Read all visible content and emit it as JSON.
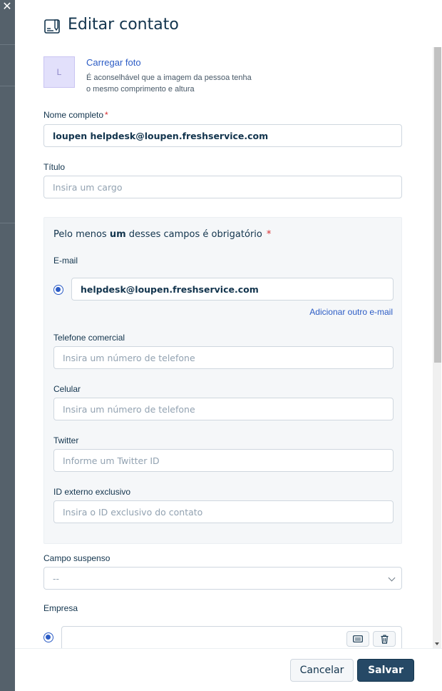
{
  "backdrop": {
    "close_glyph": "✕"
  },
  "header": {
    "title": "Editar contato",
    "icon": "contact-card-edit-icon"
  },
  "photo": {
    "avatar_initial": "L",
    "upload_label": "Carregar foto",
    "hint_line1": "É aconselhável que a imagem da pessoa tenha",
    "hint_line2": "o mesmo comprimento e altura"
  },
  "full_name": {
    "label": "Nome completo",
    "required_mark": "*",
    "value": "loupen helpdesk@loupen.freshservice.com"
  },
  "title_field": {
    "label": "Título",
    "placeholder": "Insira um cargo"
  },
  "required_group": {
    "title_before": "Pelo menos ",
    "title_bold": "um",
    "title_after": " desses campos é obrigatório",
    "required_mark": "*",
    "email": {
      "label": "E-mail",
      "value": "helpdesk@loupen.freshservice.com",
      "add_label": "Adicionar outro e-mail"
    },
    "work_phone": {
      "label": "Telefone comercial",
      "placeholder": "Insira um número de telefone"
    },
    "mobile": {
      "label": "Celular",
      "placeholder": "Insira um número de telefone"
    },
    "twitter": {
      "label": "Twitter",
      "placeholder": "Informe um Twitter ID"
    },
    "external_id": {
      "label": "ID externo exclusivo",
      "placeholder": "Insira o ID exclusivo do contato"
    }
  },
  "dropdown": {
    "label": "Campo suspenso",
    "value": "--"
  },
  "company": {
    "label": "Empresa",
    "value": ""
  },
  "footer": {
    "cancel_label": "Cancelar",
    "save_label": "Salvar"
  },
  "colors": {
    "accent": "#2c5cc5",
    "primary_button": "#264966",
    "required": "#d72d30"
  }
}
